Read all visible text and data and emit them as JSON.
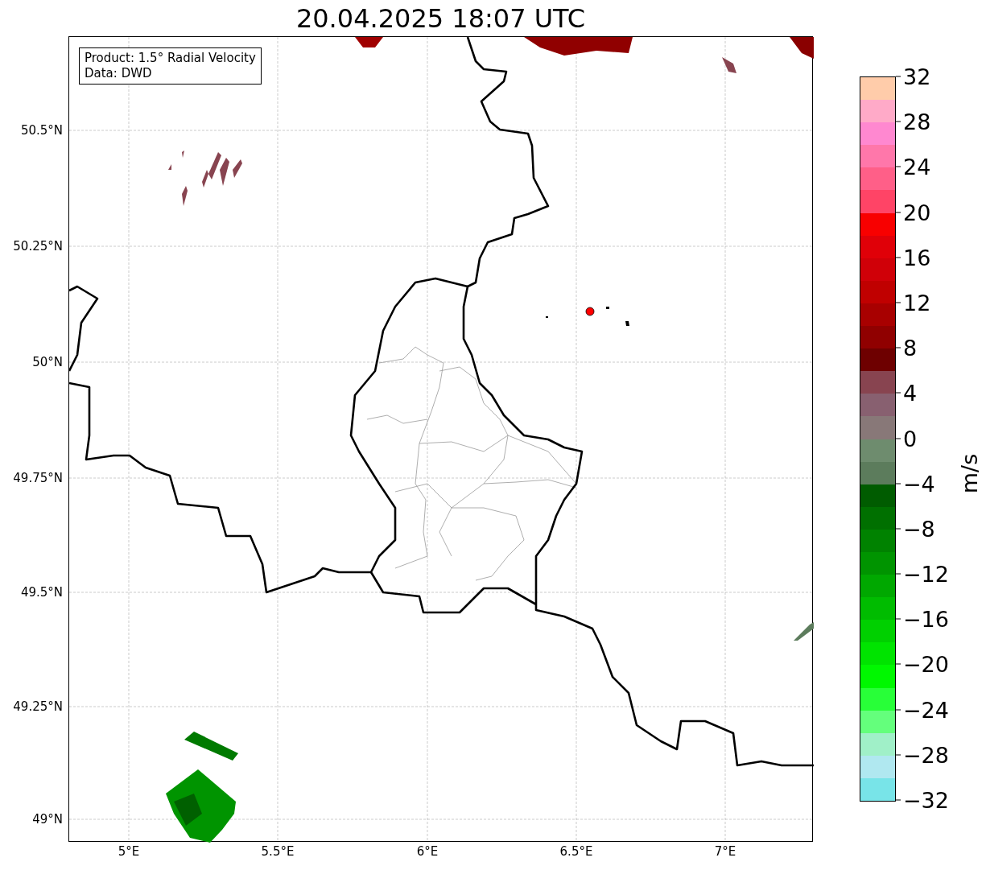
{
  "title": "20.04.2025 18:07 UTC",
  "legend": {
    "lines": [
      "Product: 1.5° Radial Velocity",
      "Data: DWD"
    ]
  },
  "map": {
    "lat_ticks": [
      "50.5°N",
      "50.25°N",
      "50°N",
      "49.75°N",
      "49.5°N",
      "49.25°N",
      "49°N"
    ],
    "lon_ticks": [
      "5°E",
      "5.5°E",
      "6°E",
      "6.5°E",
      "7°E"
    ]
  },
  "colorbar": {
    "label": "m/s",
    "ticks": [
      "32",
      "28",
      "24",
      "20",
      "16",
      "12",
      "8",
      "4",
      "0",
      "−4",
      "−8",
      "−12",
      "−16",
      "−20",
      "−24",
      "−28",
      "−32"
    ],
    "bands": [
      {
        "color": "#ffccaa"
      },
      {
        "color": "#ffaac8"
      },
      {
        "color": "#ff88d0"
      },
      {
        "color": "#ff77aa"
      },
      {
        "color": "#ff5f88"
      },
      {
        "color": "#ff4466"
      },
      {
        "color": "#f80000"
      },
      {
        "color": "#e00008"
      },
      {
        "color": "#d00008"
      },
      {
        "color": "#c00000"
      },
      {
        "color": "#a80000"
      },
      {
        "color": "#900000"
      },
      {
        "color": "#6e0000"
      },
      {
        "color": "#884450"
      },
      {
        "color": "#886070"
      },
      {
        "color": "#887878"
      },
      {
        "color": "#6e8c6e"
      },
      {
        "color": "#5c7c5c"
      },
      {
        "color": "#005c00"
      },
      {
        "color": "#007000"
      },
      {
        "color": "#008200"
      },
      {
        "color": "#009400"
      },
      {
        "color": "#00a800"
      },
      {
        "color": "#00bc00"
      },
      {
        "color": "#00d000"
      },
      {
        "color": "#00e400"
      },
      {
        "color": "#00f800"
      },
      {
        "color": "#28ff38"
      },
      {
        "color": "#64ff7c"
      },
      {
        "color": "#a0f0c8"
      },
      {
        "color": "#b0e8f0"
      },
      {
        "color": "#78e4e8"
      }
    ]
  }
}
